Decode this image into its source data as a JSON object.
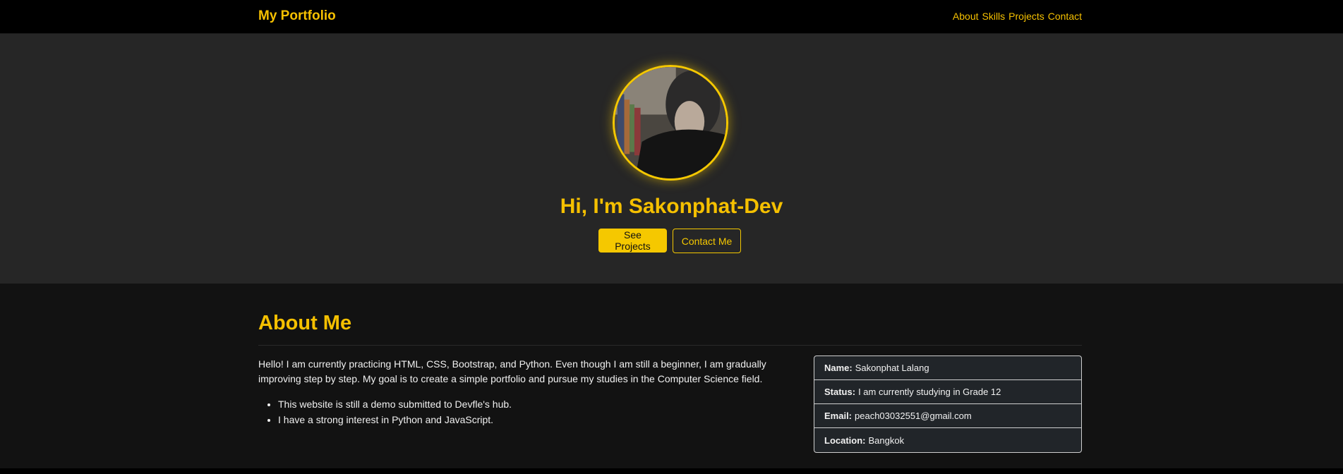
{
  "navbar": {
    "brand": "My Portfolio",
    "links": [
      "About",
      "Skills",
      "Projects",
      "Contact"
    ]
  },
  "hero": {
    "greeting": "Hi, I'm",
    "name": "Sakonphat-Dev",
    "primary_button": "See Projects",
    "secondary_button": "Contact Me"
  },
  "about": {
    "heading": "About Me",
    "paragraph": "Hello! I am currently practicing HTML, CSS, Bootstrap, and Python. Even though I am still a beginner, I am gradually improving step by step. My goal is to create a simple portfolio and pursue my studies in the Computer Science field.",
    "bullets": [
      "This website is still a demo submitted to Devfle's hub.",
      "I have a strong interest in Python and JavaScript."
    ],
    "info": [
      {
        "label": "Name:",
        "value": "Sakonphat Lalang"
      },
      {
        "label": "Status:",
        "value": "I am currently studying in Grade 12"
      },
      {
        "label": "Email:",
        "value": "peach03032551@gmail.com"
      },
      {
        "label": "Location:",
        "value": "Bangkok"
      }
    ]
  },
  "colors": {
    "accent": "#f5c000",
    "nav_bg": "#000000",
    "hero_bg": "#262626",
    "about_bg": "#121212",
    "card_bg": "#212529"
  }
}
